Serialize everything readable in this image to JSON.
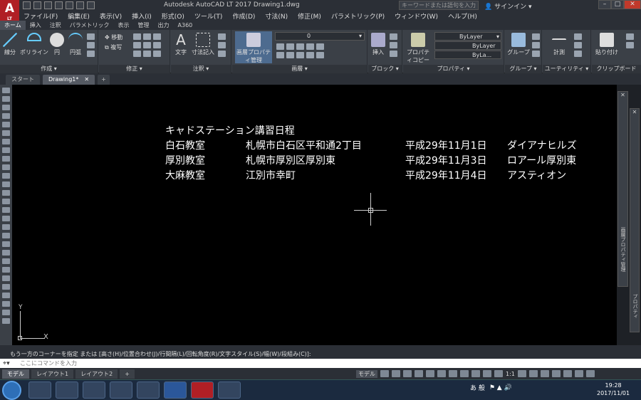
{
  "window": {
    "title": "Autodesk AutoCAD LT 2017    Drawing1.dwg",
    "logo": "A",
    "logo_sub": "LT",
    "search_placeholder": "キーワードまたは語句を入力",
    "signin": "サインイン"
  },
  "menu": [
    "ファイル(F)",
    "編集(E)",
    "表示(V)",
    "挿入(I)",
    "形式(O)",
    "ツール(T)",
    "作成(D)",
    "寸法(N)",
    "修正(M)",
    "パラメトリック(P)",
    "ウィンドウ(W)",
    "ヘルプ(H)"
  ],
  "ribbon_tabs": [
    "ホーム",
    "挿入",
    "注釈",
    "パラメトリック",
    "表示",
    "管理",
    "出力",
    "A360"
  ],
  "ribbon": {
    "draw": {
      "line": "線分",
      "polyline": "ポリライン",
      "circle": "円",
      "arc": "円弧",
      "label": "作成 ▾"
    },
    "modify": {
      "move": "移動",
      "copy": "複写",
      "label": "修正 ▾"
    },
    "annotation": {
      "text": "文字",
      "dim": "寸法記入",
      "label": "注釈 ▾"
    },
    "layers": {
      "props": "画層プロパティ管理",
      "layer_value": "0",
      "label": "画層 ▾"
    },
    "block": {
      "insert": "挿入",
      "label": "ブロック ▾"
    },
    "properties": {
      "match": "プロパティコピー",
      "bylayer1": "ByLayer",
      "bylayer2": "ByLayer",
      "bylayer3": "ByLa...",
      "label": "プロパティ ▾"
    },
    "groups": {
      "group": "グループ",
      "label": "グループ ▾"
    },
    "utilities": {
      "measure": "計測",
      "label": "ユーティリティ ▾"
    },
    "clipboard": {
      "paste": "貼り付け",
      "label": "クリップボード"
    }
  },
  "doc_tabs": [
    "スタート",
    "Drawing1*"
  ],
  "drawing": {
    "title": "キャドステーション講習日程",
    "rows": [
      {
        "name": "白石教室",
        "address": "札幌市白石区平和通2丁目",
        "date": "平成29年11月1日",
        "venue": "ダイアナヒルズ"
      },
      {
        "name": "厚別教室",
        "address": "札幌市厚別区厚別東",
        "date": "平成29年11月3日",
        "venue": "ロアール厚別東"
      },
      {
        "name": "大麻教室",
        "address": "江別市幸町",
        "date": "平成29年11月4日",
        "venue": "アスティオン"
      }
    ],
    "ucs_x": "X",
    "ucs_y": "Y"
  },
  "side_panels": {
    "props": "画層プロパティ管理",
    "palette": "プロパティ"
  },
  "command": {
    "history": "もう一方のコーナーを指定 または [高さ(H)/位置合わせ(J)/行間隔(L)/回転角度(R)/文字スタイル(S)/幅(W)/段組み(C)]:",
    "placeholder": "ここにコマンドを入力"
  },
  "layout_tabs": [
    "モデル",
    "レイアウト1",
    "レイアウト2"
  ],
  "status": {
    "model": "モデル",
    "scale": "1:1"
  },
  "taskbar": {
    "time": "19:28",
    "date": "2017/11/01",
    "ime": "あ 般"
  }
}
